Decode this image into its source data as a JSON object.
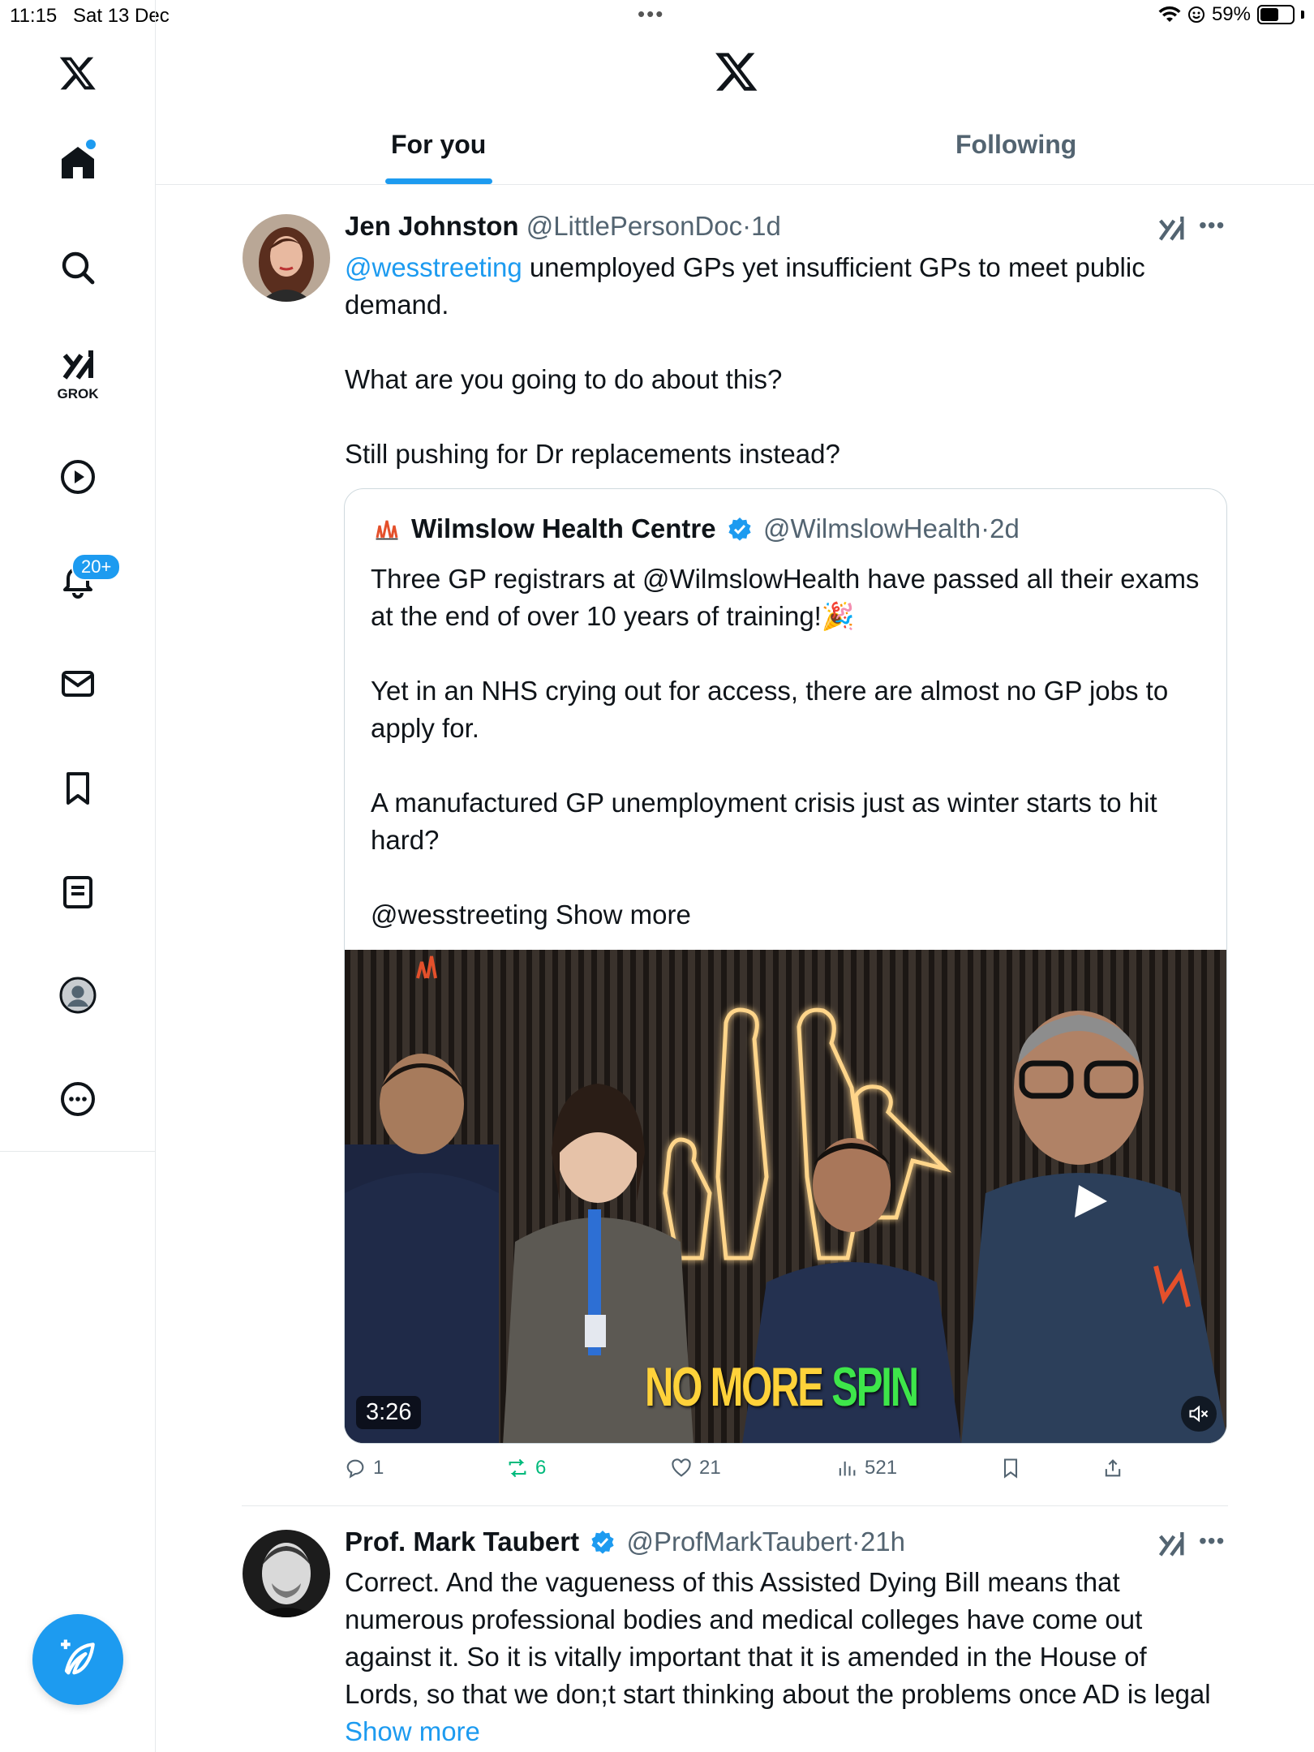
{
  "status_bar": {
    "time": "11:15",
    "date": "Sat 13 Dec",
    "battery": "59%",
    "battery_level": 0.59
  },
  "sidebar": {
    "grok_label": "GROK",
    "notifications_badge": "20+"
  },
  "tabs": [
    {
      "label": "For you",
      "selected": true
    },
    {
      "label": "Following",
      "selected": false
    }
  ],
  "tweets": [
    {
      "name": "Jen Johnston",
      "handle": "@LittlePersonDoc",
      "time": "1d",
      "mention": "@wesstreeting",
      "text_after_mention": " unemployed GPs yet  insufficient GPs to meet public demand.\n\nWhat are you going to do about this?\n\nStill pushing for Dr replacements instead?",
      "quote": {
        "name": "Wilmslow Health Centre",
        "handle": "@WilmslowHealth",
        "time": "2d",
        "text": "Three GP registrars at @WilmslowHealth have passed all their exams at the end of over 10 years of training!🎉\n\nYet in an NHS crying out for access, there are almost no GP jobs to apply for.\n\nA manufactured GP unemployment crisis just as winter starts to hit hard?\n\n@wesstreeting Show more",
        "video": {
          "caption_part1": "NO MORE ",
          "caption_part2": "SPIN",
          "duration": "3:26"
        }
      },
      "actions": {
        "replies": "1",
        "reposts": "6",
        "likes": "21",
        "views": "521"
      }
    },
    {
      "name": "Prof. Mark Taubert",
      "handle": "@ProfMarkTaubert",
      "time": "21h",
      "text": "Correct. And the vagueness of this Assisted Dying Bill means that numerous professional bodies and medical colleges have come out against it. So it is vitally important that it is amended in the House of Lords, so that we don;t start thinking about the problems once AD is legal ",
      "show_more": "Show more"
    }
  ],
  "colors": {
    "accent": "#1d9bf0",
    "text": "#0f1419",
    "secondary": "#536471",
    "repost": "#00ba7c",
    "border": "#e6e9eb"
  }
}
